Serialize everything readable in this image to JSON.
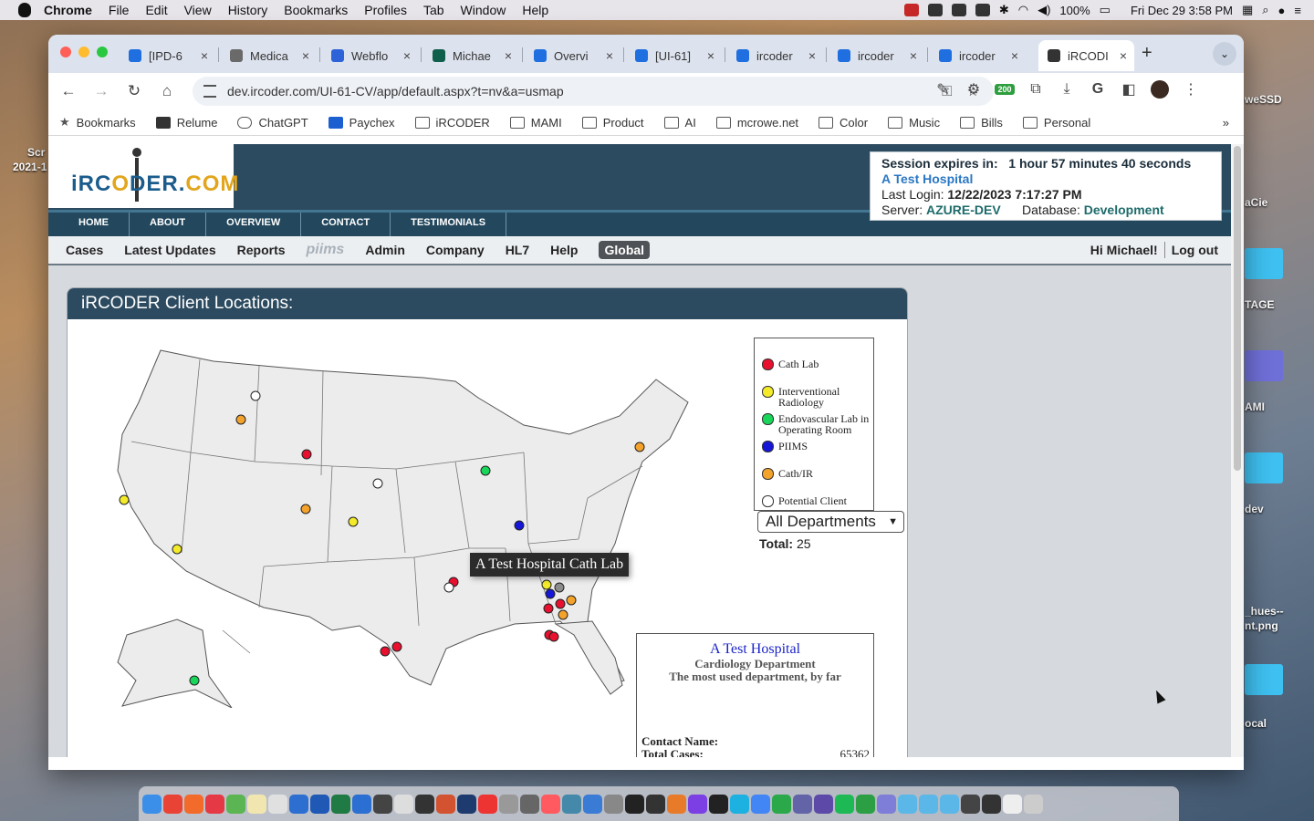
{
  "menubar": {
    "app": "Chrome",
    "items": [
      "File",
      "Edit",
      "View",
      "History",
      "Bookmarks",
      "Profiles",
      "Tab",
      "Window",
      "Help"
    ],
    "battery": "100%",
    "clock": "Fri Dec 29  3:58 PM"
  },
  "desktop": {
    "labels": [
      "Scr",
      "2021-1",
      "weSSD",
      "aCie",
      "TAGE",
      "AMI",
      "dev",
      "_hues--",
      "nt.png",
      "ocal"
    ]
  },
  "tabs": [
    {
      "label": "[IPD-6",
      "color": "#1f6fe0"
    },
    {
      "label": "Medica",
      "color": "#6a6a6a"
    },
    {
      "label": "Webflo",
      "color": "#2d62d8"
    },
    {
      "label": "Michae",
      "color": "#0f5f4d"
    },
    {
      "label": "Overvi",
      "color": "#1f6fe0"
    },
    {
      "label": "[UI-61]",
      "color": "#1f6fe0"
    },
    {
      "label": "ircoder",
      "color": "#1f6fe0"
    },
    {
      "label": "ircoder",
      "color": "#1f6fe0"
    },
    {
      "label": "ircoder",
      "color": "#1f6fe0"
    },
    {
      "label": "iRCODI",
      "color": "#333333",
      "active": true
    }
  ],
  "toolbar": {
    "url": "dev.ircoder.com/UI-61-CV/app/default.aspx?t=nv&a=usmap",
    "ext_badge": "200"
  },
  "bookmarks": [
    "Bookmarks",
    "Relume",
    "ChatGPT",
    "Paychex",
    "iRCODER",
    "MAMI",
    "Product",
    "AI",
    "mcrowe.net",
    "Color",
    "Music",
    "Bills",
    "Personal"
  ],
  "site": {
    "logo_text_a": "iRC",
    "logo_text_b": "O",
    "logo_text_c": "DER.",
    "logo_text_d": "COM",
    "session": {
      "expires_label": "Session expires in:",
      "expires_value": "1 hour 57 minutes 40 seconds",
      "hospital": "A Test Hospital",
      "last_login_label": "Last Login:",
      "last_login_value": "12/22/2023 7:17:27 PM",
      "server_label": "Server:",
      "server_value": "AZURE-DEV",
      "database_label": "Database:",
      "database_value": "Development"
    },
    "topnav": [
      "HOME",
      "ABOUT",
      "OVERVIEW",
      "CONTACT",
      "TESTIMONIALS"
    ],
    "mainnav": [
      "Cases",
      "Latest Updates",
      "Reports",
      "piims",
      "Admin",
      "Company",
      "HL7",
      "Help",
      "Global"
    ],
    "greeting": "Hi Michael!",
    "logout": "Log out"
  },
  "card": {
    "title": "iRCODER Client Locations:",
    "legend": [
      {
        "label": "Cath Lab",
        "color": "#e8102e"
      },
      {
        "label": "Interventional Radiology",
        "color": "#f3ea2a"
      },
      {
        "label": "Endovascular Lab in Operating Room",
        "color": "#19d65a"
      },
      {
        "label": "PIIMS",
        "color": "#1616d8"
      },
      {
        "label": "Cath/IR",
        "color": "#f3a22c"
      },
      {
        "label": "Potential Client",
        "color": "#ffffff"
      }
    ],
    "department_select": "All Departments",
    "total_label": "Total:",
    "total_value": "25",
    "tooltip": "A Test Hospital Cath Lab",
    "info": {
      "name": "A Test Hospital",
      "department": "Cardiology Department",
      "note": "The most used department, by far",
      "contact_label": "Contact Name:",
      "cases_label": "Total Cases:",
      "cases_value": "65362"
    }
  }
}
